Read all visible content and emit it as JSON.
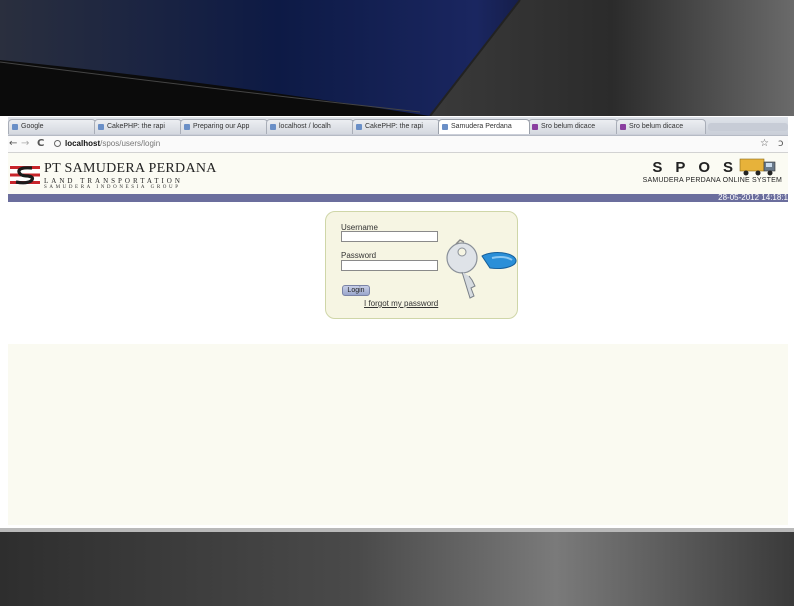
{
  "browser": {
    "tabs": [
      {
        "label": "Google",
        "active": false
      },
      {
        "label": "CakePHP: the rapi",
        "active": false
      },
      {
        "label": "Preparing our App",
        "active": false
      },
      {
        "label": "localhost / localh",
        "active": false
      },
      {
        "label": "CakePHP: the rapi",
        "active": false
      },
      {
        "label": "Samudera Perdana",
        "active": true
      },
      {
        "label": "Sro belum dicace",
        "active": false
      },
      {
        "label": "Sro belum dicace",
        "active": false
      }
    ],
    "url_host": "localhost",
    "url_path": "/spos/users/login",
    "icons": [
      "back-arrow-icon",
      "forward-arrow-icon",
      "reload-icon",
      "star-icon",
      "wrench-icon"
    ]
  },
  "header": {
    "company_name": "PT SAMUDERA PERDANA",
    "company_sub1": "LAND TRANSPORTATION",
    "company_sub2": "SAMUDERA INDONESIA GROUP",
    "app_letters": "SPOS",
    "app_tagline": "SAMUDERA PERDANA ONLINE SYSTEM",
    "datetime": "28-05-2012 14:18:1"
  },
  "login": {
    "username_label": "Username",
    "password_label": "Password",
    "username_value": "",
    "password_value": "",
    "login_button": "Login",
    "forgot_link": "I forgot my password"
  },
  "colors": {
    "header_bg": "#fbfbf3",
    "datebar": "#6b6e9d",
    "login_panel": "#f6f5e3",
    "logo_red": "#c8252b",
    "key_blue": "#2a8fd8"
  }
}
